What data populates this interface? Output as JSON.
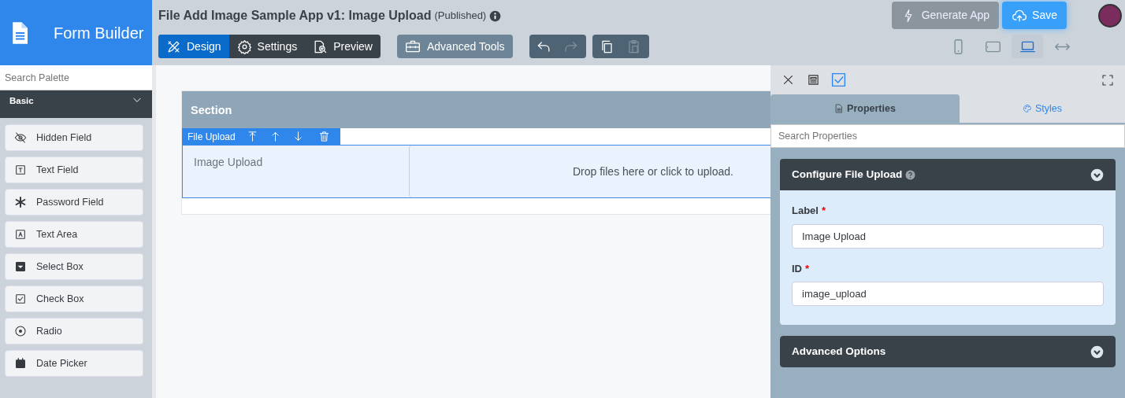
{
  "app": {
    "title": "Form Builder"
  },
  "palette": {
    "search": {
      "placeholder": "Search Palette"
    },
    "group": {
      "label": "Basic",
      "expanded": true
    },
    "items": [
      {
        "label": "Hidden Field",
        "kind": "hidden"
      },
      {
        "label": "Text Field",
        "kind": "text"
      },
      {
        "label": "Password Field",
        "kind": "password"
      },
      {
        "label": "Text Area",
        "kind": "textarea"
      },
      {
        "label": "Select Box",
        "kind": "select"
      },
      {
        "label": "Check Box",
        "kind": "checkbox"
      },
      {
        "label": "Radio",
        "kind": "radio"
      },
      {
        "label": "Date Picker",
        "kind": "date"
      }
    ]
  },
  "header": {
    "title": "File Add Image Sample App v1: Image Upload",
    "status": "(Published)"
  },
  "mode_tabs": [
    {
      "label": "Design",
      "kind": "design",
      "selected": true
    },
    {
      "label": "Settings",
      "kind": "settings",
      "selected": false
    },
    {
      "label": "Preview",
      "kind": "preview",
      "selected": false
    }
  ],
  "advanced_tools": {
    "label": "Advanced Tools"
  },
  "history": [
    {
      "kind": "undo",
      "disabled": false
    },
    {
      "kind": "redo",
      "disabled": true
    }
  ],
  "clipboard": [
    {
      "kind": "copy",
      "disabled": false
    },
    {
      "kind": "paste",
      "disabled": true
    }
  ],
  "generate_button": {
    "label": "Generate App"
  },
  "save_button": {
    "label": "Save"
  },
  "devices": [
    {
      "kind": "mobile",
      "selected": false
    },
    {
      "kind": "tablet",
      "selected": false
    },
    {
      "kind": "laptop",
      "selected": true
    },
    {
      "kind": "fluid",
      "selected": false
    }
  ],
  "canvas": {
    "section_title": "Section",
    "component": {
      "type_label": "File Upload",
      "label": "Image Upload",
      "dropzone_text": "Drop files here or click to upload."
    }
  },
  "panel": {
    "toolbar": [
      {
        "kind": "close",
        "selected": false
      },
      {
        "kind": "compact",
        "selected": false
      },
      {
        "kind": "check",
        "selected": true
      }
    ],
    "tabs": [
      {
        "label": "Properties",
        "kind": "properties",
        "selected": true
      },
      {
        "label": "Styles",
        "kind": "styles",
        "selected": false
      }
    ],
    "search": {
      "placeholder": "Search Properties"
    },
    "accordions": [
      {
        "title": "Configure File Upload",
        "help": true,
        "expanded": true,
        "fields": [
          {
            "label": "Label",
            "required_mark": "*",
            "value": "Image Upload"
          },
          {
            "label": "ID",
            "required_mark": "*",
            "value": "image_upload"
          }
        ]
      },
      {
        "title": "Advanced Options",
        "help": false,
        "expanded": false
      }
    ]
  }
}
